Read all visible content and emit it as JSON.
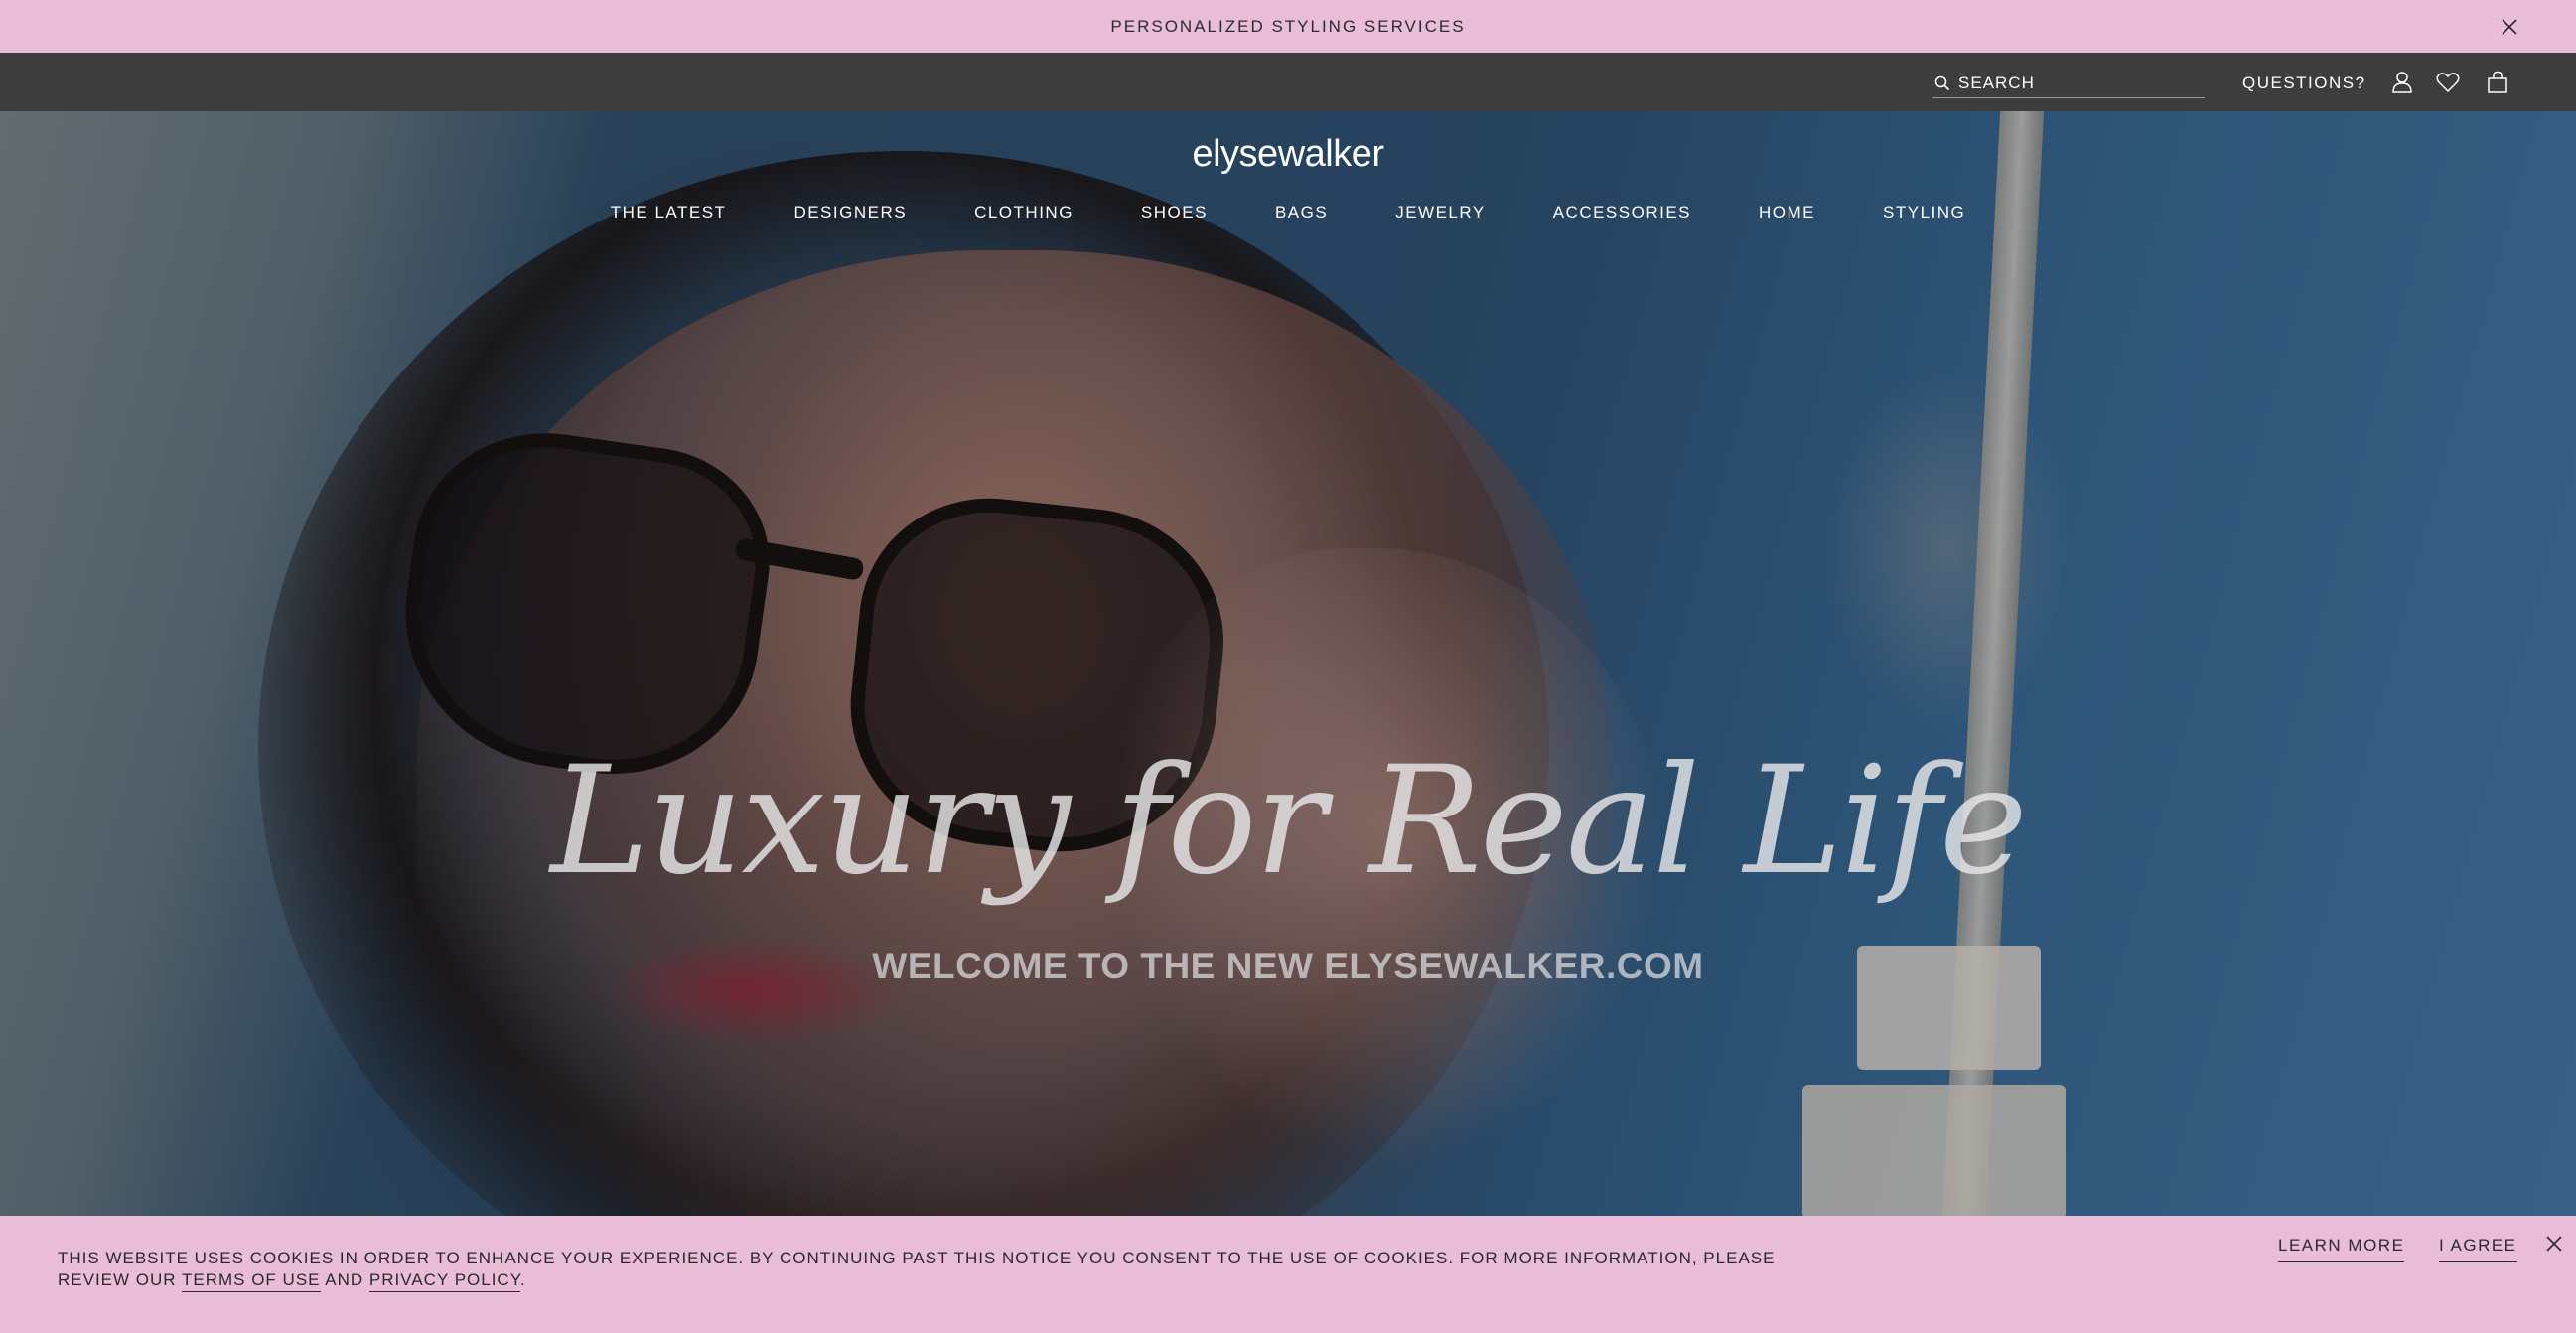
{
  "promo": {
    "text": "PERSONALIZED STYLING SERVICES",
    "close_icon": "close-icon"
  },
  "utility": {
    "search_placeholder": "SEARCH",
    "search_icon": "search-icon",
    "questions_label": "QUESTIONS?",
    "icons": [
      "user-icon",
      "heart-icon",
      "shopping-bag-icon"
    ]
  },
  "header": {
    "logo": "elysewalker",
    "nav": [
      "THE LATEST",
      "DESIGNERS",
      "CLOTHING",
      "SHOES",
      "BAGS",
      "JEWELRY",
      "ACCESSORIES",
      "HOME",
      "STYLING"
    ]
  },
  "hero": {
    "script_headline": "Luxury for Real Life",
    "subheadline": "WELCOME TO THE NEW ELYSEWALKER.COM"
  },
  "cookie": {
    "text_before": "THIS WEBSITE USES COOKIES IN ORDER TO ENHANCE YOUR EXPERIENCE. BY CONTINUING PAST THIS NOTICE YOU CONSENT TO THE USE OF COOKIES. FOR MORE INFORMATION, PLEASE REVIEW OUR ",
    "terms_link": "TERMS OF USE",
    "and": " AND ",
    "privacy_link": "PRIVACY POLICY",
    "period": ".",
    "learn_more": "LEARN MORE",
    "agree": "I AGREE",
    "close_icon": "close-icon"
  },
  "colors": {
    "promo_bg": "#e9bcd8",
    "utility_bg": "#3d3d3d",
    "text_dark": "#2a2a2a",
    "text_light": "#ffffff"
  }
}
